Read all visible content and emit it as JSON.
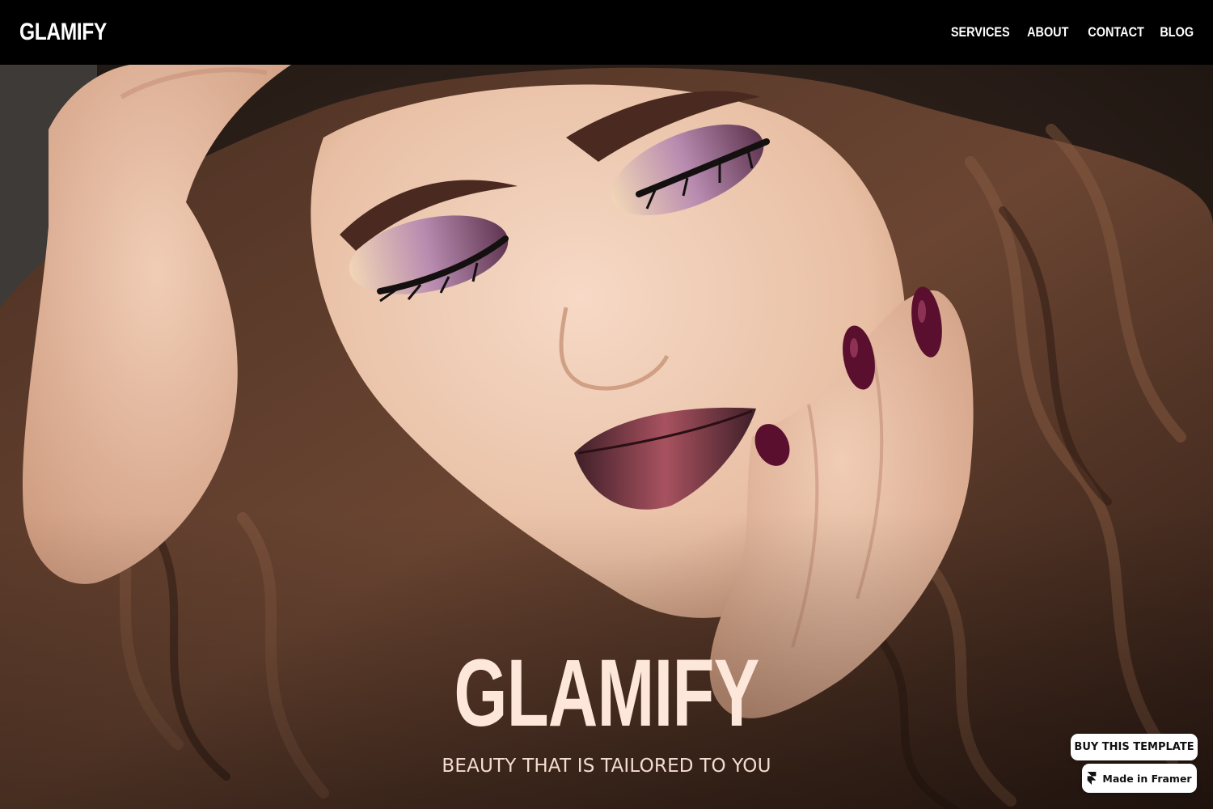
{
  "header": {
    "logo": "GLAMIFY",
    "nav": [
      {
        "label": "SERVICES"
      },
      {
        "label": "ABOUT"
      },
      {
        "label": "CONTACT"
      },
      {
        "label": "BLOG"
      }
    ]
  },
  "hero": {
    "title": "GLAMIFY",
    "subtitle": "BEAUTY THAT IS TAILORED TO YOU",
    "image_alt": "woman-portrait-photo"
  },
  "badges": {
    "buy_label": "BUY THIS TEMPLATE",
    "framer_label": "Made in Framer",
    "framer_icon": "framer-logo-icon"
  },
  "colors": {
    "nav_bg": "#000000",
    "hero_text": "#fde6da",
    "nail_polish": "#5a0f2e",
    "lip_color": "#5e2a38"
  }
}
